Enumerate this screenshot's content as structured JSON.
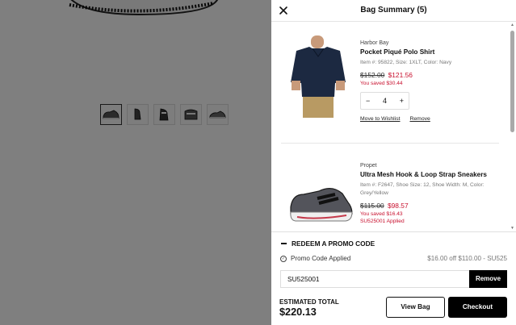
{
  "drawer": {
    "title": "Bag Summary (5)",
    "close_icon": "close-icon"
  },
  "items": [
    {
      "brand": "Harbor Bay",
      "name": "Pocket Piqué Polo Shirt",
      "meta": "Item #: 95822, Size: 1XLT, Color: Navy",
      "original_price": "$152.00",
      "sale_price": "$121.56",
      "saved": "You saved $30.44",
      "quantity": "4",
      "move_label": "Move to Wishlist",
      "remove_label": "Remove"
    },
    {
      "brand": "Propet",
      "name": "Ultra Mesh Hook & Loop Strap Sneakers",
      "meta": "Item #: F2647, Shoe Size: 12, Shoe Width: M, Color: Grey/Yellow",
      "original_price": "$115.00",
      "sale_price": "$98.57",
      "saved": "You saved $16.43",
      "applied": "SU525001 Applied"
    }
  ],
  "promo": {
    "header": "REDEEM A PROMO CODE",
    "applied_label": "Promo Code Applied",
    "applied_value": "$16.00 off $110.00 - SU525",
    "code": "SU525001",
    "remove_label": "Remove"
  },
  "totals": {
    "label": "ESTIMATED TOTAL",
    "value": "$220.13"
  },
  "buttons": {
    "view_bag": "View Bag",
    "checkout": "Checkout"
  },
  "colors": {
    "sale": "#c8102e",
    "overlay": "rgba(0,0,0,0.5)",
    "button_dark": "#000000"
  }
}
